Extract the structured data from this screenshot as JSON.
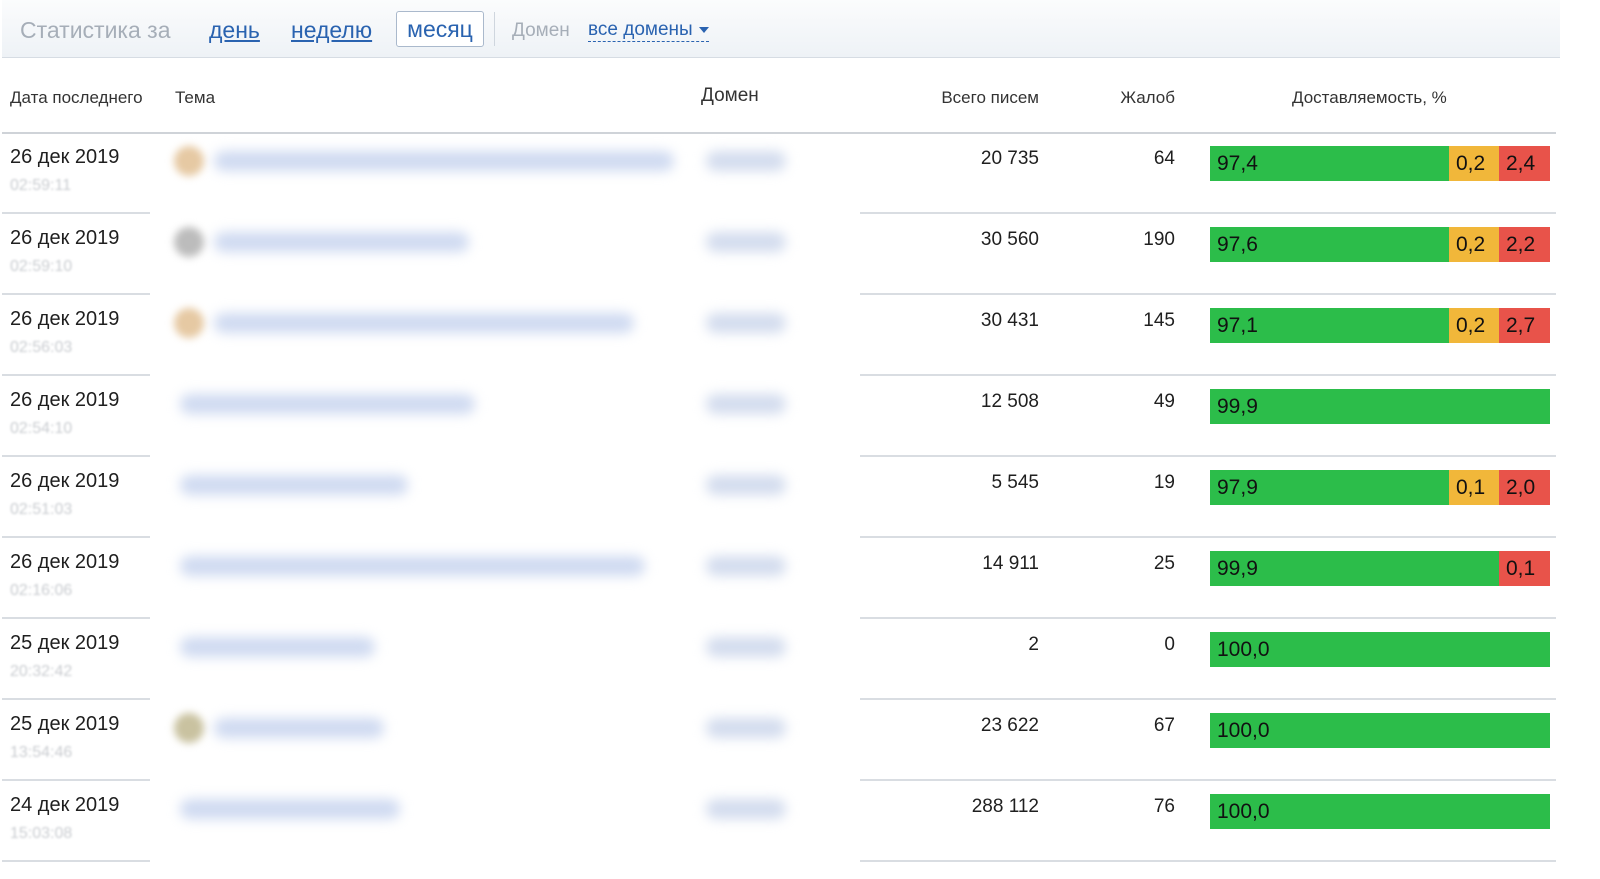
{
  "toolbar": {
    "label": "Статистика за",
    "periods": {
      "day": "день",
      "week": "неделю",
      "month": "месяц"
    },
    "active_period": "month",
    "domain_label": "Домен",
    "domain_value": "все домены"
  },
  "table": {
    "headers": {
      "date": "Дата последнего",
      "subject": "Тема",
      "domain": "Домен",
      "total": "Всего писем",
      "complaints": "Жалоб",
      "deliverability": "Доставляемость, %"
    },
    "rows": [
      {
        "date": "26 дек 2019",
        "time": "02:59:11",
        "total": "20 735",
        "complaints": "64",
        "delivered": "97,4",
        "spam": "0,2",
        "failed": "2,4"
      },
      {
        "date": "26 дек 2019",
        "time": "02:59:10",
        "total": "30 560",
        "complaints": "190",
        "delivered": "97,6",
        "spam": "0,2",
        "failed": "2,2"
      },
      {
        "date": "26 дек 2019",
        "time": "02:56:03",
        "total": "30 431",
        "complaints": "145",
        "delivered": "97,1",
        "spam": "0,2",
        "failed": "2,7"
      },
      {
        "date": "26 дек 2019",
        "time": "02:54:10",
        "total": "12 508",
        "complaints": "49",
        "delivered": "99,9",
        "spam": "",
        "failed": ""
      },
      {
        "date": "26 дек 2019",
        "time": "02:51:03",
        "total": "5 545",
        "complaints": "19",
        "delivered": "97,9",
        "spam": "0,1",
        "failed": "2,0"
      },
      {
        "date": "26 дек 2019",
        "time": "02:16:06",
        "total": "14 911",
        "complaints": "25",
        "delivered": "99,9",
        "spam": "",
        "failed": "0,1"
      },
      {
        "date": "25 дек 2019",
        "time": "20:32:42",
        "total": "2",
        "complaints": "0",
        "delivered": "100,0",
        "spam": "",
        "failed": ""
      },
      {
        "date": "25 дек 2019",
        "time": "13:54:46",
        "total": "23 622",
        "complaints": "67",
        "delivered": "100,0",
        "spam": "",
        "failed": ""
      },
      {
        "date": "24 дек 2019",
        "time": "15:03:08",
        "total": "288 112",
        "complaints": "76",
        "delivered": "100,0",
        "spam": "",
        "failed": ""
      }
    ]
  },
  "colors": {
    "delivered": "#2cbd4a",
    "spam": "#f1b73a",
    "failed": "#e8534a",
    "link": "#2a63b0"
  }
}
